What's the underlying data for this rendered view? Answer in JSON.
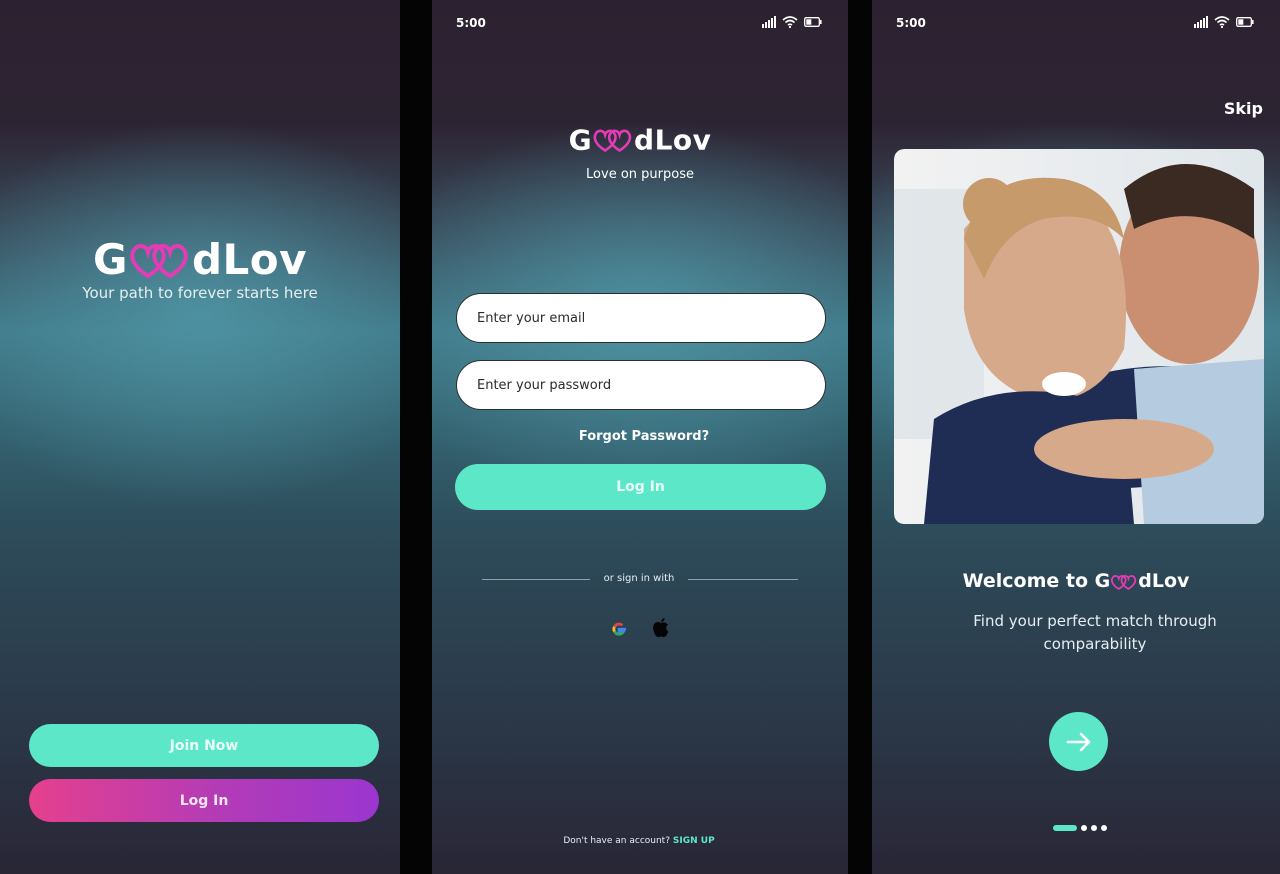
{
  "brand": {
    "logo_prefix": "G",
    "logo_suffix": "dLov",
    "heart_color": "#e33cb5",
    "accent_green": "#5ce8c8"
  },
  "splash": {
    "tagline": "Your path to forever starts here",
    "join_label": "Join Now",
    "login_label": "Log In"
  },
  "login": {
    "status_time": "5:00",
    "tagline": "Love on purpose",
    "email_placeholder": "Enter your email",
    "password_placeholder": "Enter your password",
    "forgot_label": "Forgot Password?",
    "login_label": "Log In",
    "divider_text": "or sign in with",
    "social_icons": [
      "google-icon",
      "apple-icon"
    ],
    "signup_prompt": "Don't have an account?",
    "signup_link": "SIGN UP"
  },
  "onboarding": {
    "status_time": "5:00",
    "skip_label": "Skip",
    "welcome_prefix": "Welcome to",
    "subtitle": "Find your perfect match through comparability",
    "next_icon": "arrow-right-icon",
    "page_count": 4,
    "current_page": 1
  }
}
